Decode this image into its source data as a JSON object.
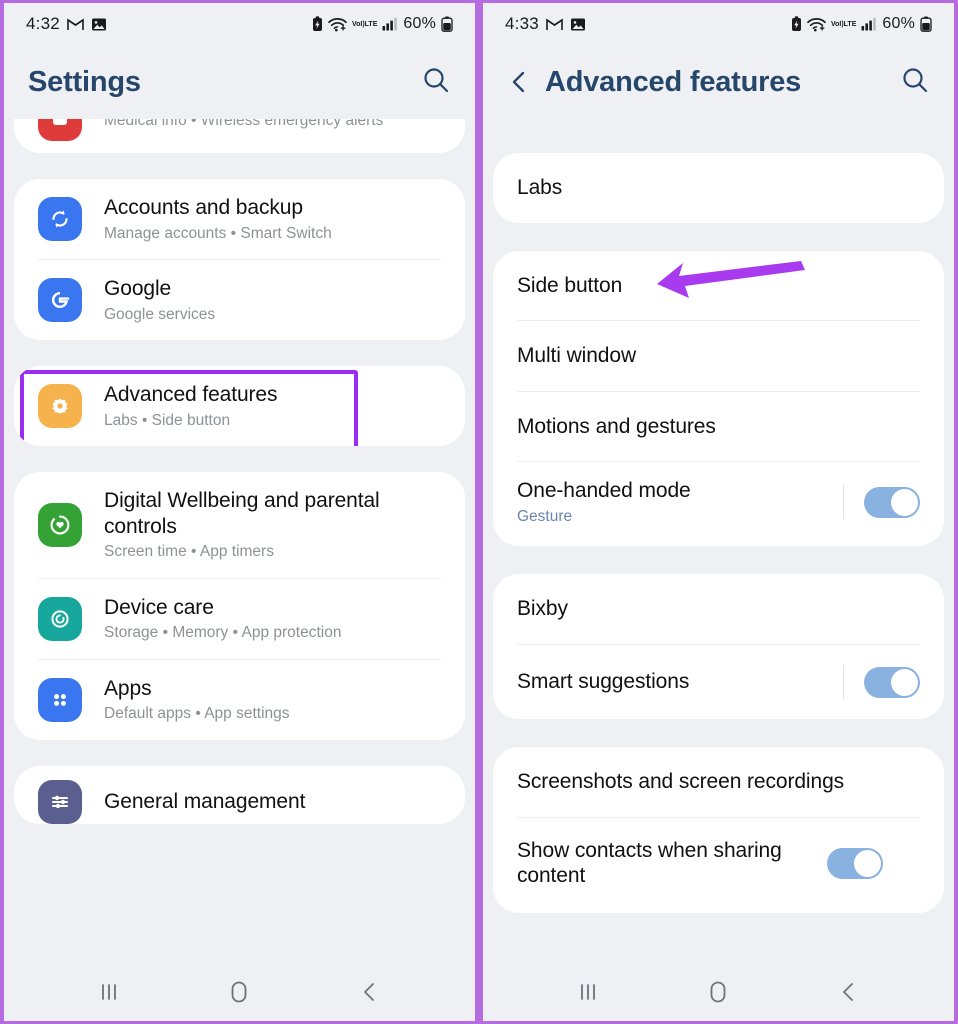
{
  "left_phone": {
    "status_bar": {
      "time": "4:32",
      "battery_percent": "60%",
      "icons": [
        "gmail-icon",
        "photos-icon",
        "battery-saver-icon",
        "wifi-icon",
        "volte-icon",
        "signal-icon",
        "battery-icon"
      ],
      "volte_top": "VoI)",
      "volte_bottom": "LTE"
    },
    "header": {
      "title": "Settings",
      "search_icon": "search-icon"
    },
    "groups": [
      {
        "items": [
          {
            "title": "",
            "subtitle": "Medical info  •  Wireless emergency alerts",
            "icon_color": "#e03b3b",
            "icon": "safety-icon",
            "clipped": true
          }
        ]
      },
      {
        "items": [
          {
            "title": "Accounts and backup",
            "subtitle": "Manage accounts  •  Smart Switch",
            "icon_color": "#3a76f0",
            "icon": "sync-icon"
          },
          {
            "title": "Google",
            "subtitle": "Google services",
            "icon_color": "#3a76f0",
            "icon": "google-icon"
          }
        ]
      },
      {
        "items": [
          {
            "title": "Advanced features",
            "subtitle": "Labs  •  Side button",
            "icon_color": "#f5b24d",
            "icon": "advanced-features-icon",
            "highlighted": true
          }
        ]
      },
      {
        "items": [
          {
            "title": "Digital Wellbeing and parental controls",
            "subtitle": "Screen time  •  App timers",
            "icon_color": "#35a236",
            "icon": "wellbeing-icon"
          },
          {
            "title": "Device care",
            "subtitle": "Storage  •  Memory  •  App protection",
            "icon_color": "#17a79d",
            "icon": "device-care-icon"
          },
          {
            "title": "Apps",
            "subtitle": "Default apps  •  App settings",
            "icon_color": "#3a76f0",
            "icon": "apps-icon"
          }
        ]
      },
      {
        "items": [
          {
            "title": "General management",
            "subtitle": "",
            "icon_color": "#5a5f8f",
            "icon": "general-management-icon"
          }
        ]
      }
    ],
    "nav_bar": {
      "recents": "recents-icon",
      "home": "home-icon",
      "back": "back-icon"
    }
  },
  "right_phone": {
    "status_bar": {
      "time": "4:33",
      "battery_percent": "60%",
      "volte_top": "VoI)",
      "volte_bottom": "LTE"
    },
    "header": {
      "title": "Advanced features",
      "back_icon": "back-chevron-icon",
      "search_icon": "search-icon"
    },
    "groups": [
      {
        "items": [
          {
            "title": "Labs",
            "toggle": null
          }
        ]
      },
      {
        "items": [
          {
            "title": "Side button",
            "toggle": null,
            "annotated": true
          },
          {
            "title": "Multi window",
            "toggle": null
          },
          {
            "title": "Motions and gestures",
            "toggle": null
          },
          {
            "title": "One-handed mode",
            "subtitle": "Gesture",
            "toggle": "on"
          }
        ]
      },
      {
        "items": [
          {
            "title": "Bixby",
            "toggle": null
          },
          {
            "title": "Smart suggestions",
            "toggle": "on"
          }
        ]
      },
      {
        "items": [
          {
            "title": "Screenshots and screen recordings",
            "toggle": null
          },
          {
            "title": "Show contacts when sharing content",
            "toggle": "on"
          }
        ]
      }
    ],
    "nav_bar": {
      "recents": "recents-icon",
      "home": "home-icon",
      "back": "back-icon"
    }
  },
  "annotations": {
    "highlight_color": "#9a2df0",
    "arrow_color": "#a83bf0",
    "arrow_target": "Side button",
    "frame_border_color": "#b46ce0"
  }
}
